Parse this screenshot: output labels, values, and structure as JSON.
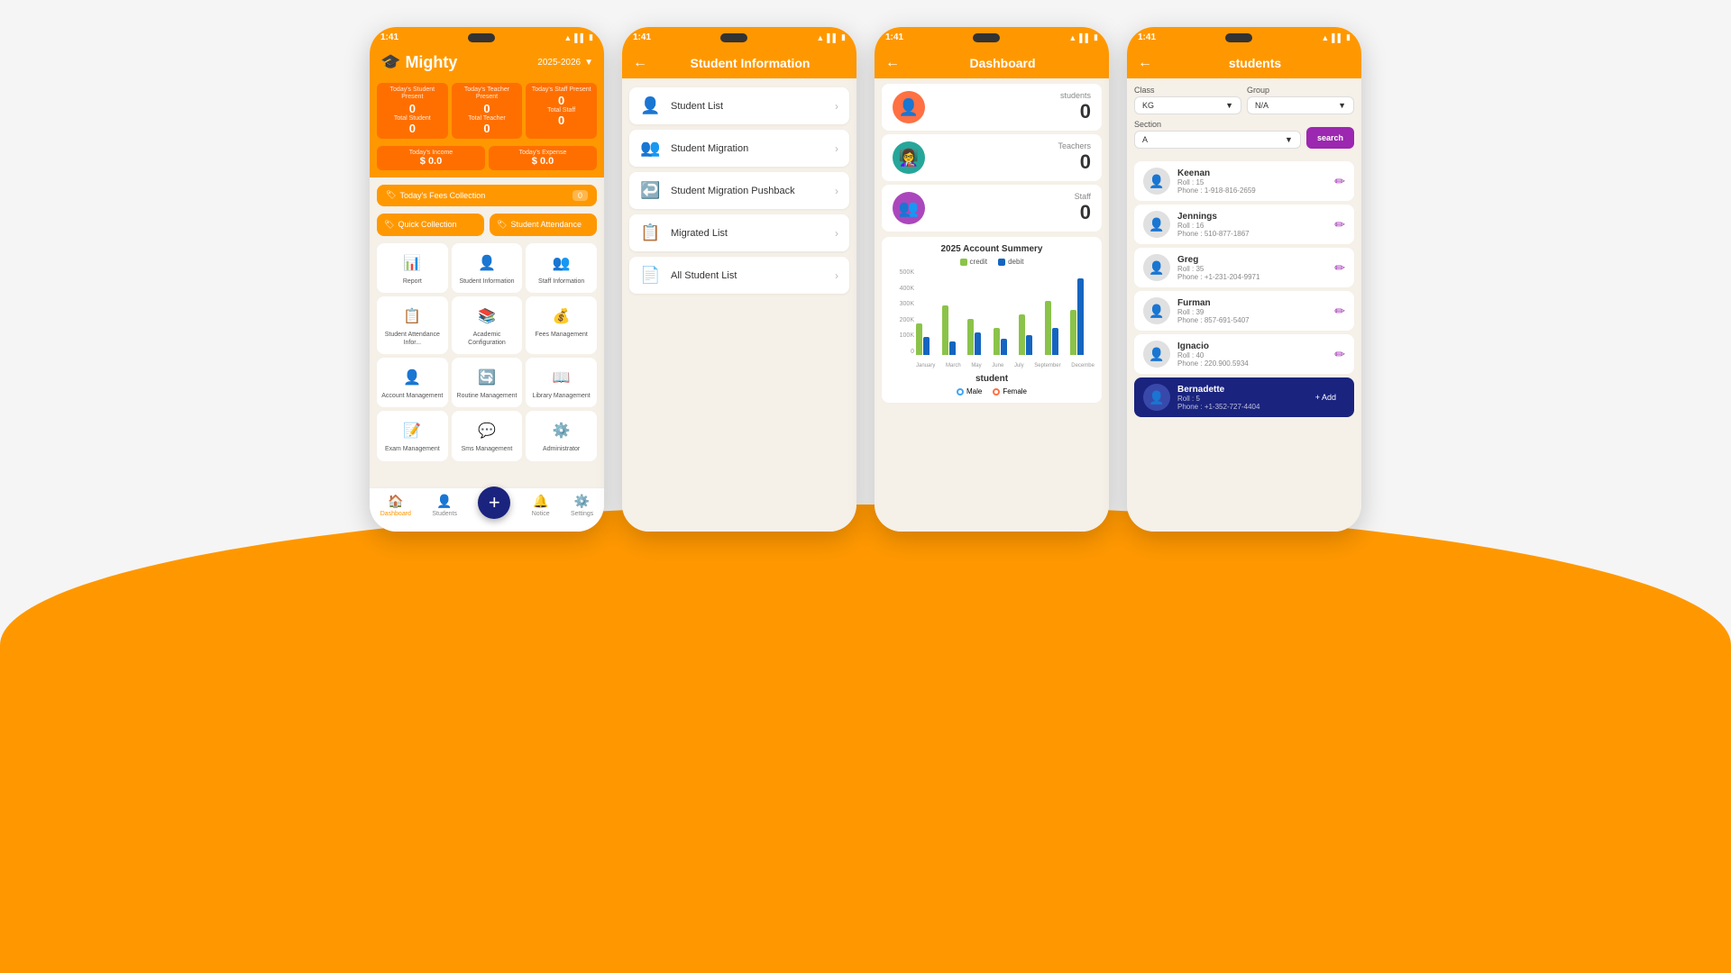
{
  "background": {
    "color": "#FF9800"
  },
  "phone1": {
    "status_time": "1:41",
    "header": {
      "logo": "Mighty",
      "year": "2025-2026"
    },
    "stats": [
      {
        "label": "Today's Student Present",
        "value": "0",
        "sub": "Total Student",
        "sub_value": "0"
      },
      {
        "label": "Today's Teacher Present",
        "value": "0",
        "sub": "Total Teacher",
        "sub_value": "0"
      },
      {
        "label": "Today's Staff Present",
        "value": "0",
        "sub": "Total Staff",
        "sub_value": "0"
      }
    ],
    "income": [
      {
        "label": "Today's Income",
        "value": "$ 0.0"
      },
      {
        "label": "Today's Expense",
        "value": "$ 0.0"
      }
    ],
    "fees_collection": "Today's Fees Collection",
    "fees_badge": "0",
    "quick_collection": "Quick Collection",
    "student_attendance": "Student Attendance",
    "menu_items": [
      {
        "label": "Report",
        "icon": "📊"
      },
      {
        "label": "Student Information",
        "icon": "👤"
      },
      {
        "label": "Staff Information",
        "icon": "👥"
      },
      {
        "label": "Student Attendance Infor...",
        "icon": "📋"
      },
      {
        "label": "Academic Configuration",
        "icon": "📚"
      },
      {
        "label": "Fees Management",
        "icon": "💰"
      },
      {
        "label": "Account Management",
        "icon": "👤"
      },
      {
        "label": "Routine Management",
        "icon": "🔄"
      },
      {
        "label": "Library Management",
        "icon": "📖"
      },
      {
        "label": "Exam Management",
        "icon": "📝"
      },
      {
        "label": "Sms Management",
        "icon": "💬"
      },
      {
        "label": "Administrator",
        "icon": "⚙️"
      }
    ],
    "footer": [
      {
        "label": "Dashboard",
        "icon": "🏠",
        "active": true
      },
      {
        "label": "Students",
        "icon": "👤",
        "active": false
      },
      {
        "label": "Notice",
        "icon": "🔔",
        "active": false
      },
      {
        "label": "Settings",
        "icon": "⚙️",
        "active": false
      }
    ]
  },
  "phone2": {
    "status_time": "1:41",
    "header": {
      "title": "Student Information"
    },
    "menu_items": [
      {
        "label": "Student List",
        "icon": "👤"
      },
      {
        "label": "Student Migration",
        "icon": "👥"
      },
      {
        "label": "Student Migration Pushback",
        "icon": "↩️"
      },
      {
        "label": "Migrated List",
        "icon": "📋"
      },
      {
        "label": "All Student List",
        "icon": "📄"
      }
    ]
  },
  "phone3": {
    "status_time": "1:41",
    "header": {
      "title": "Dashboard"
    },
    "stats": [
      {
        "label": "students",
        "value": "0",
        "color": "#FF7043"
      },
      {
        "label": "Teachers",
        "value": "0",
        "color": "#26A69A"
      },
      {
        "label": "Staff",
        "value": "0",
        "color": "#AB47BC"
      }
    ],
    "chart": {
      "title": "2025 Account Summery",
      "legend": [
        {
          "label": "credit",
          "color": "#8BC34A"
        },
        {
          "label": "debit",
          "color": "#1565C0"
        }
      ],
      "y_labels": [
        "500K",
        "400K",
        "300K",
        "200K",
        "100K",
        "0"
      ],
      "x_labels": [
        "January",
        "March",
        "May",
        "June",
        "July",
        "September",
        "December"
      ],
      "bars": [
        {
          "credit": 35,
          "debit": 20
        },
        {
          "credit": 55,
          "debit": 15
        },
        {
          "credit": 40,
          "debit": 25
        },
        {
          "credit": 30,
          "debit": 18
        },
        {
          "credit": 45,
          "debit": 22
        },
        {
          "credit": 60,
          "debit": 30
        },
        {
          "credit": 50,
          "debit": 85
        }
      ]
    },
    "gender_label": "student",
    "legend_male": "Male",
    "legend_female": "Female"
  },
  "phone4": {
    "status_time": "1:41",
    "header": {
      "title": "students"
    },
    "filters": {
      "class_label": "Class",
      "class_value": "KG",
      "group_label": "Group",
      "group_value": "N/A",
      "section_label": "Section",
      "section_value": "A",
      "search_btn": "search"
    },
    "students": [
      {
        "name": "Keenan",
        "roll": "15",
        "phone": "1-918-816-2659"
      },
      {
        "name": "Jennings",
        "roll": "16",
        "phone": "510-877-1867"
      },
      {
        "name": "Greg",
        "roll": "35",
        "phone": "+1-231-204-9971"
      },
      {
        "name": "Furman",
        "roll": "39",
        "phone": "857-691-5407"
      },
      {
        "name": "Ignacio",
        "roll": "40",
        "phone": "220.900.5934"
      },
      {
        "name": "Bernadette",
        "roll": "5",
        "phone": "+1-352-727-4404"
      }
    ],
    "add_btn": "+ Add"
  }
}
